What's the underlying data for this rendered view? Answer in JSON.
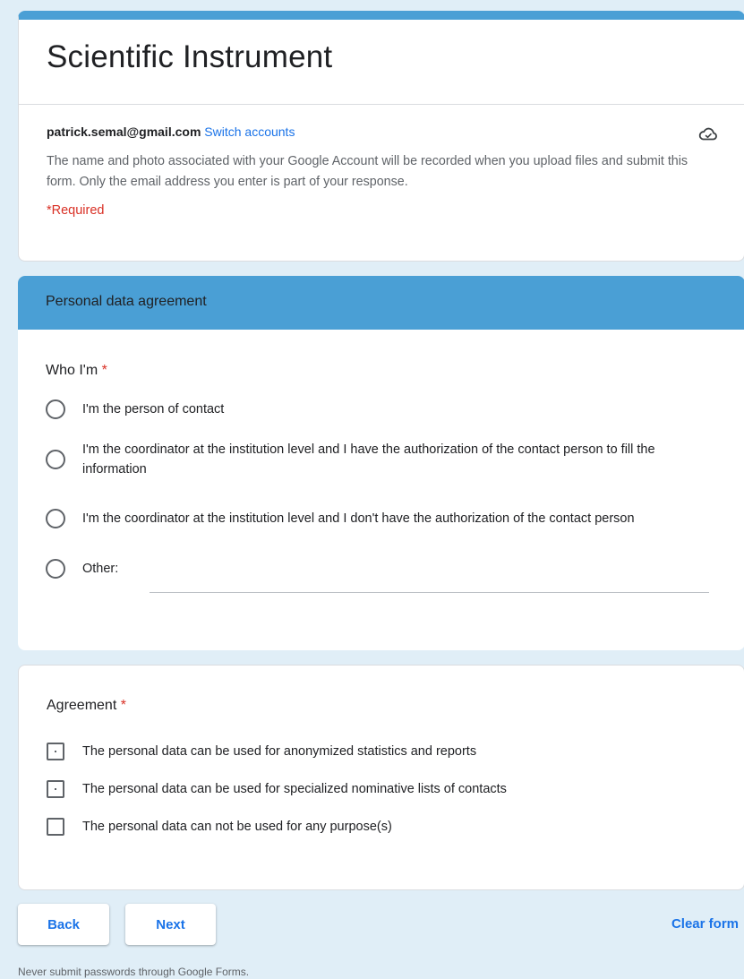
{
  "form": {
    "title": "Scientific Instrument",
    "account_email": "patrick.semal@gmail.com",
    "switch_accounts": "Switch accounts",
    "cloud_icon": "cloud-sync-icon",
    "notice": "The name and photo associated with your Google Account will be recorded when you upload files and submit this form. Only the email address you enter is part of your response.",
    "required_note": "*Required"
  },
  "section": {
    "title": "Personal data agreement"
  },
  "question_who": {
    "title": "Who I'm",
    "required_mark": "*",
    "options": [
      "I'm the person of contact",
      "I'm the coordinator at the institution level and I have the authorization of the contact person to fill the information",
      "I'm the coordinator at the institution level and I don't have the authorization of the contact person",
      "Other:"
    ]
  },
  "question_agreement": {
    "title": "Agreement",
    "required_mark": "*",
    "options": [
      "The personal data can be used for anonymized statistics and reports",
      "The personal data can be used for specialized nominative lists of contacts",
      "The personal data can not be used for any purpose(s)"
    ]
  },
  "nav": {
    "back": "Back",
    "next": "Next",
    "clear": "Clear form"
  },
  "footer": {
    "note": "Never submit passwords through Google Forms."
  },
  "colors": {
    "accent": "#4a9fd5",
    "background": "#e0eef7",
    "link": "#1a73e8",
    "required": "#d93025"
  }
}
